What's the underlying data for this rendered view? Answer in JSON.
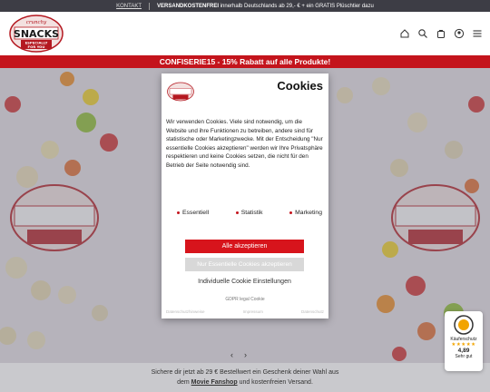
{
  "topbar": {
    "link": "KONTAKT",
    "shipping_bold": "VERSANDKOSTENFREI",
    "shipping_rest": "innerhalb Deutschlands ab 29,- € + ein GRATIS Plüschtier dazu"
  },
  "logo": {
    "top": "crunchy",
    "main": "SNACKS",
    "sub1": "ESPECIALLY",
    "sub2": "FOR YOU"
  },
  "header_icons": [
    "home-icon",
    "search-icon",
    "cart-icon",
    "user-icon",
    "menu-icon"
  ],
  "promo": "CONFISERIE15 - 15% Rabatt auf alle Produkte!",
  "modal": {
    "title": "Cookies",
    "text": "Wir verwenden Cookies. Viele sind notwendig, um die Website und ihre Funktionen zu betreiben, andere sind für statistische oder Marketingzwecke. Mit der Entscheidung \"Nur essentielle Cookies akzeptieren\" werden wir Ihre Privatsphäre respektieren und keine Cookies setzen, die nicht für den Betrieb der Seite notwendig sind.",
    "checks": [
      "Essentiell",
      "Statistik",
      "Marketing"
    ],
    "accept_all": "Alle akzeptieren",
    "accept_essential": "Nur Essentielle Cookies akzeptieren",
    "individual": "Individuelle Cookie Einstellungen",
    "gdpr": "GDPR legal Cookie",
    "links": [
      "Datenschutzhinweise",
      "Impressum",
      "Datenschutz"
    ]
  },
  "footer": {
    "line1": "Sichere dir jetzt ab 29 € Bestellwert ein Geschenk deiner Wahl aus",
    "line2_pre": "dem",
    "line2_link": "Movie Fanshop",
    "line2_post": "und kostenfreien Versand."
  },
  "carousel": {
    "prev": "‹",
    "next": "›"
  },
  "trust_badge": {
    "label": "Käuferschutz",
    "stars": "★★★★★",
    "score": "4,89",
    "rating": "Sehr gut"
  },
  "colors": {
    "brand_red": "#c4141c",
    "topbar": "#3d3d45"
  }
}
